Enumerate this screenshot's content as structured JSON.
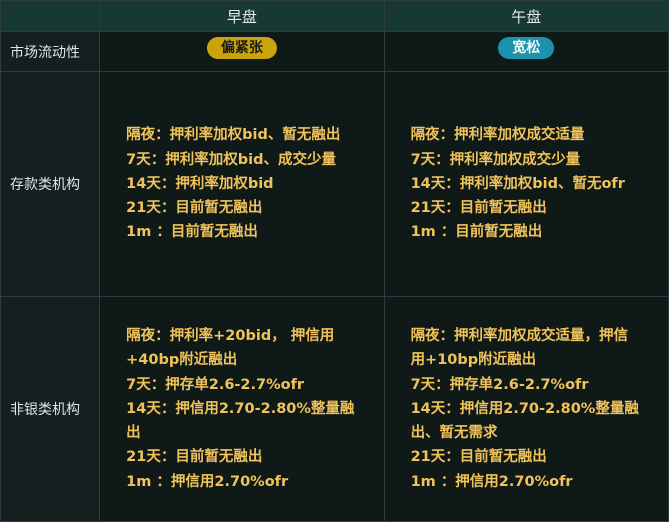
{
  "header": {
    "morning": "早盘",
    "afternoon": "午盘"
  },
  "rows": {
    "liquidity": {
      "label": "市场流动性",
      "morning_badge": "偏紧张",
      "afternoon_badge": "宽松"
    },
    "deposit": {
      "label": "存款类机构",
      "morning_lines": [
        "隔夜：押利率加权bid、暂无融出",
        "7天：押利率加权bid、成交少量",
        "14天：押利率加权bid",
        "21天：目前暂无融出",
        "1m ：目前暂无融出"
      ],
      "afternoon_lines": [
        "隔夜：押利率加权成交适量",
        "7天：押利率加权成交少量",
        "14天：押利率加权bid、暂无ofr",
        "21天：目前暂无融出",
        "1m ：目前暂无融出"
      ]
    },
    "nonbank": {
      "label": "非银类机构",
      "morning_lines": [
        "隔夜：押利率+20bid， 押信用",
        "+40bp附近融出",
        "7天：押存单2.6-2.7%ofr",
        "14天：押信用2.70-2.80%整量融",
        "出",
        "21天：目前暂无融出",
        "1m ：押信用2.70%ofr"
      ],
      "afternoon_lines": [
        "隔夜：押利率加权成交适量，押信",
        "用+10bp附近融出",
        "7天：押存单2.6-2.7%ofr",
        "14天：押信用2.70-2.80%整量融",
        "出、暂无需求",
        "21天：目前暂无融出",
        "1m ：押信用2.70%ofr"
      ]
    }
  },
  "colors": {
    "badge_tight": "#c9a40c",
    "badge_loose": "#1b93ad",
    "highlight_text": "#f0c25a",
    "header_bg": "#173833"
  }
}
